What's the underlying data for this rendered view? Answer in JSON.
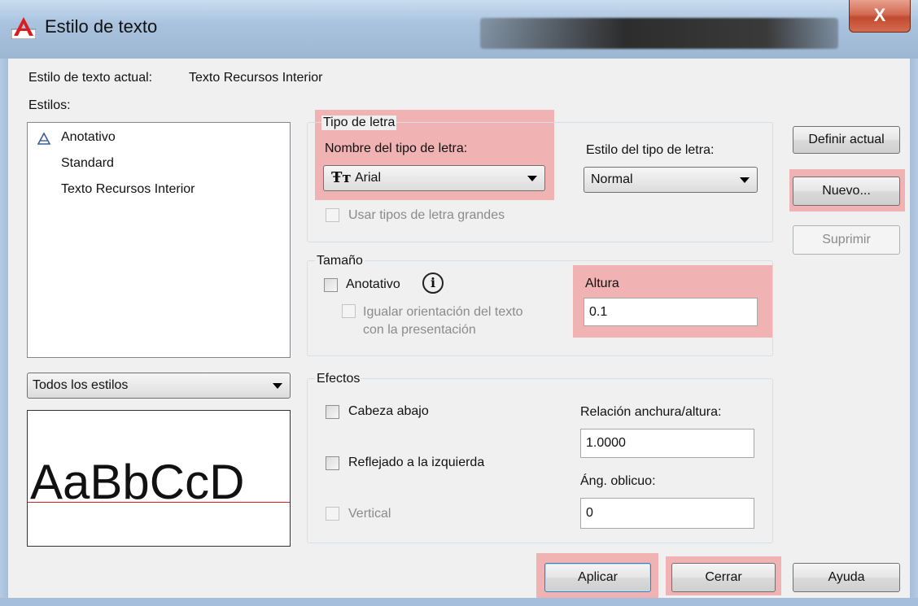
{
  "window": {
    "title": "Estilo de texto",
    "close_glyph": "X"
  },
  "current_style": {
    "label": "Estilo de texto actual:",
    "value": "Texto Recursos Interior"
  },
  "styles": {
    "label": "Estilos:",
    "items": [
      {
        "label": "Anotativo",
        "icon": "annotative-icon"
      },
      {
        "label": "Standard"
      },
      {
        "label": "Texto Recursos Interior",
        "selected": true
      }
    ],
    "filter_value": "Todos los estilos"
  },
  "preview": {
    "sample": "AaBbCcD"
  },
  "font_group": {
    "legend": "Tipo de letra",
    "font_name_label": "Nombre del tipo de letra:",
    "font_name_value": "Arial",
    "font_icon": "truetype-icon",
    "font_style_label": "Estilo del tipo de letra:",
    "font_style_value": "Normal",
    "big_fonts_label": "Usar tipos de letra grandes"
  },
  "size_group": {
    "legend": "Tamaño",
    "annotative_label": "Anotativo",
    "info_icon": "info-icon",
    "match_orientation_label_1": "Igualar orientación del texto",
    "match_orientation_label_2": "con la presentación",
    "height_label": "Altura",
    "height_value": "0.1"
  },
  "effects_group": {
    "legend": "Efectos",
    "upside_down_label": "Cabeza abajo",
    "backwards_label": "Reflejado a la izquierda",
    "vertical_label": "Vertical",
    "width_factor_label": "Relación anchura/altura:",
    "width_factor_value": "1.0000",
    "oblique_label": "Áng. oblicuo:",
    "oblique_value": "0"
  },
  "buttons": {
    "set_current": "Definir actual",
    "new": "Nuevo...",
    "delete": "Suprimir",
    "apply": "Aplicar",
    "close": "Cerrar",
    "help": "Ayuda"
  },
  "colors": {
    "highlight": "#f08c8c",
    "preview_baseline": "#d02020",
    "title_bar": "#a9c3df"
  }
}
